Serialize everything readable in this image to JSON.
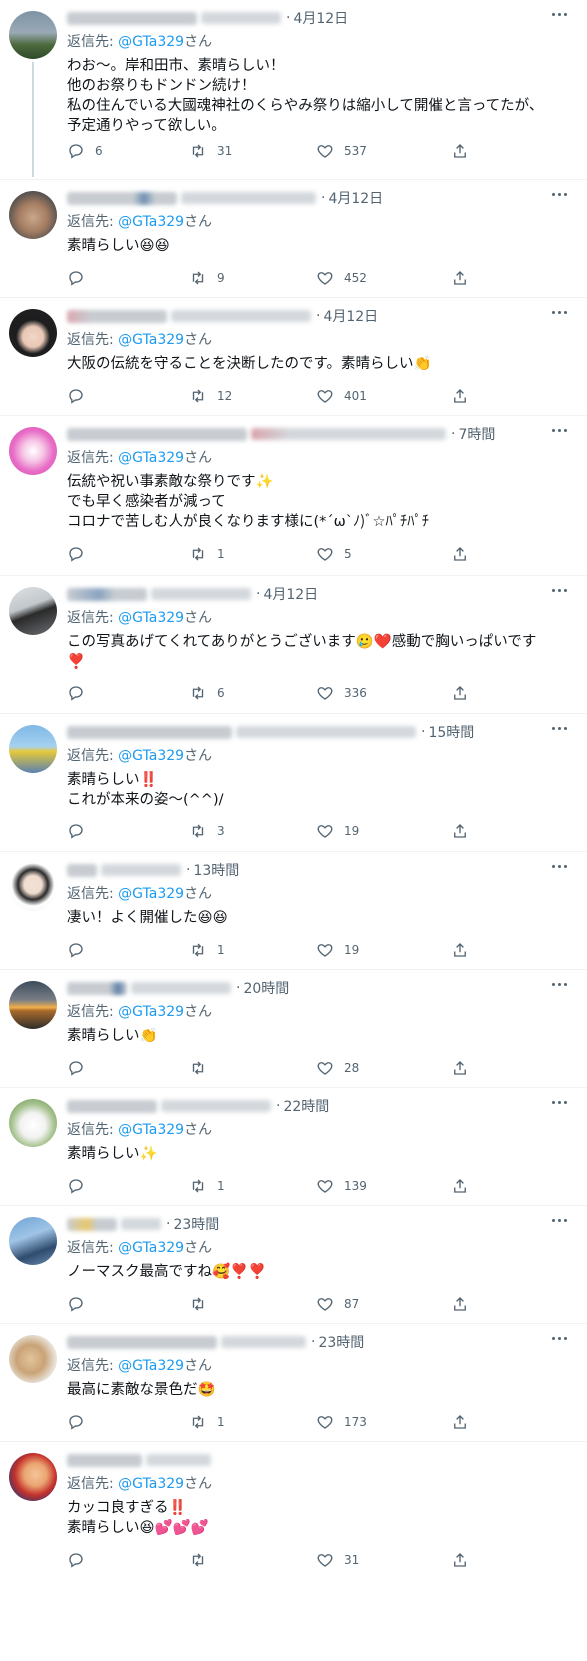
{
  "ui": {
    "reply_prefix": "返信先: ",
    "reply_suffix": "さん"
  },
  "tweets": [
    {
      "time": "4月12日",
      "reply_to": "@GTa329",
      "lines": [
        "わお～。岸和田市、素晴らしい！",
        "他のお祭りもドンドン続け！",
        "私の住んでいる大國魂神社のくらやみ祭りは縮小して開催と言ってたが、",
        "予定通りやって欲しい。"
      ],
      "replies": "6",
      "retweets": "31",
      "likes": "537"
    },
    {
      "time": "4月12日",
      "reply_to": "@GTa329",
      "lines": [
        "素晴らしい😆😆"
      ],
      "replies": "",
      "retweets": "9",
      "likes": "452"
    },
    {
      "time": "4月12日",
      "reply_to": "@GTa329",
      "lines": [
        "大阪の伝統を守ることを決断したのです。素晴らしい👏"
      ],
      "replies": "",
      "retweets": "12",
      "likes": "401"
    },
    {
      "time": "7時間",
      "reply_to": "@GTa329",
      "lines": [
        "伝統や祝い事素敵な祭りです✨",
        "でも早く感染者が減って",
        "コロナで苦しむ人が良くなります様に(*´ω`ﾉ)ﾞ☆ﾊﾟﾁﾊﾟﾁ"
      ],
      "replies": "",
      "retweets": "1",
      "likes": "5"
    },
    {
      "time": "4月12日",
      "reply_to": "@GTa329",
      "lines": [
        "この写真あげてくれてありがとうございます🥲❤️感動で胸いっぱいです",
        "❣️"
      ],
      "replies": "",
      "retweets": "6",
      "likes": "336"
    },
    {
      "time": "15時間",
      "reply_to": "@GTa329",
      "lines": [
        "素晴らしい‼️",
        "これが本来の姿～(^^)/"
      ],
      "replies": "",
      "retweets": "3",
      "likes": "19"
    },
    {
      "time": "13時間",
      "reply_to": "@GTa329",
      "lines": [
        "凄い！よく開催した😆😆"
      ],
      "replies": "",
      "retweets": "1",
      "likes": "19"
    },
    {
      "time": "20時間",
      "reply_to": "@GTa329",
      "lines": [
        "素晴らしい👏"
      ],
      "replies": "",
      "retweets": "",
      "likes": "28"
    },
    {
      "time": "22時間",
      "reply_to": "@GTa329",
      "lines": [
        "素晴らしい✨"
      ],
      "replies": "",
      "retweets": "1",
      "likes": "139"
    },
    {
      "time": "23時間",
      "reply_to": "@GTa329",
      "lines": [
        "ノーマスク最高ですね🥰❣️❣️"
      ],
      "replies": "",
      "retweets": "",
      "likes": "87"
    },
    {
      "time": "23時間",
      "reply_to": "@GTa329",
      "lines": [
        "最高に素敵な景色だ🤩"
      ],
      "replies": "",
      "retweets": "1",
      "likes": "173"
    },
    {
      "time": "",
      "reply_to": "@GTa329",
      "lines": [
        "カッコ良すぎる‼️",
        "素晴らしい😆💕💕💕"
      ],
      "replies": "",
      "retweets": "",
      "likes": "31"
    }
  ],
  "icons": {
    "reply": "reply-icon",
    "retweet": "retweet-icon",
    "like": "like-icon",
    "share": "share-icon",
    "more": "more-icon"
  }
}
